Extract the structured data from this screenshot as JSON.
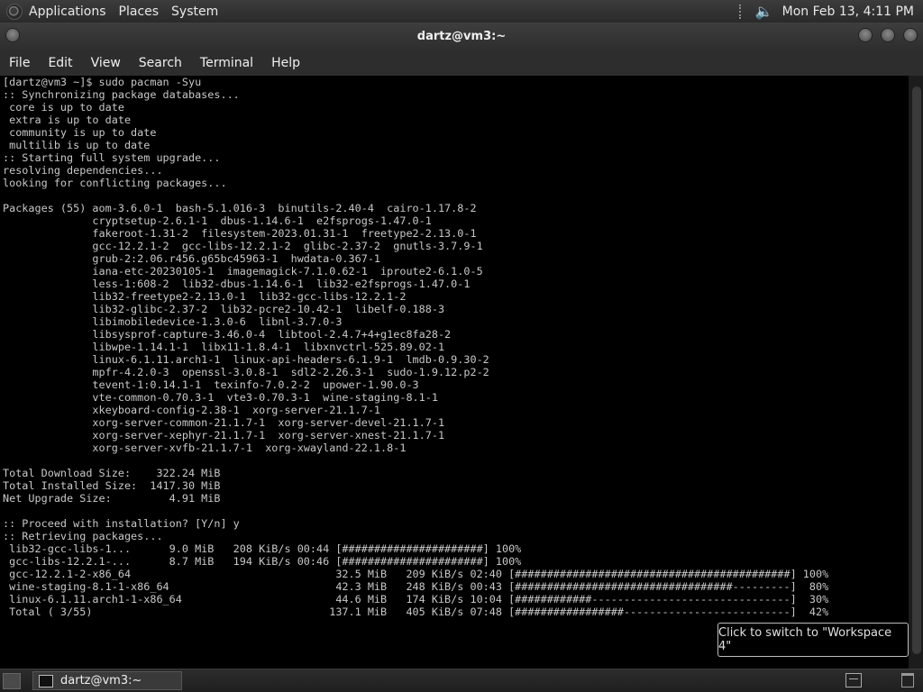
{
  "top_panel": {
    "menu": [
      "Applications",
      "Places",
      "System"
    ],
    "clock": "Mon Feb 13,  4:11 PM"
  },
  "window": {
    "title": "dartz@vm3:~",
    "menu": [
      "File",
      "Edit",
      "View",
      "Search",
      "Terminal",
      "Help"
    ]
  },
  "terminal": {
    "lines": [
      "[dartz@vm3 ~]$ sudo pacman -Syu",
      ":: Synchronizing package databases...",
      " core is up to date",
      " extra is up to date",
      " community is up to date",
      " multilib is up to date",
      ":: Starting full system upgrade...",
      "resolving dependencies...",
      "looking for conflicting packages...",
      "",
      "Packages (55) aom-3.6.0-1  bash-5.1.016-3  binutils-2.40-4  cairo-1.17.8-2",
      "              cryptsetup-2.6.1-1  dbus-1.14.6-1  e2fsprogs-1.47.0-1",
      "              fakeroot-1.31-2  filesystem-2023.01.31-1  freetype2-2.13.0-1",
      "              gcc-12.2.1-2  gcc-libs-12.2.1-2  glibc-2.37-2  gnutls-3.7.9-1",
      "              grub-2:2.06.r456.g65bc45963-1  hwdata-0.367-1",
      "              iana-etc-20230105-1  imagemagick-7.1.0.62-1  iproute2-6.1.0-5",
      "              less-1:608-2  lib32-dbus-1.14.6-1  lib32-e2fsprogs-1.47.0-1",
      "              lib32-freetype2-2.13.0-1  lib32-gcc-libs-12.2.1-2",
      "              lib32-glibc-2.37-2  lib32-pcre2-10.42-1  libelf-0.188-3",
      "              libimobiledevice-1.3.0-6  libnl-3.7.0-3",
      "              libsysprof-capture-3.46.0-4  libtool-2.4.7+4+g1ec8fa28-2",
      "              libwpe-1.14.1-1  libx11-1.8.4-1  libxnvctrl-525.89.02-1",
      "              linux-6.1.11.arch1-1  linux-api-headers-6.1.9-1  lmdb-0.9.30-2",
      "              mpfr-4.2.0-3  openssl-3.0.8-1  sdl2-2.26.3-1  sudo-1.9.12.p2-2",
      "              tevent-1:0.14.1-1  texinfo-7.0.2-2  upower-1.90.0-3",
      "              vte-common-0.70.3-1  vte3-0.70.3-1  wine-staging-8.1-1",
      "              xkeyboard-config-2.38-1  xorg-server-21.1.7-1",
      "              xorg-server-common-21.1.7-1  xorg-server-devel-21.1.7-1",
      "              xorg-server-xephyr-21.1.7-1  xorg-server-xnest-21.1.7-1",
      "              xorg-server-xvfb-21.1.7-1  xorg-xwayland-22.1.8-1",
      "",
      "Total Download Size:    322.24 MiB",
      "Total Installed Size:  1417.30 MiB",
      "Net Upgrade Size:         4.91 MiB",
      "",
      ":: Proceed with installation? [Y/n] y",
      ":: Retrieving packages...",
      " lib32-gcc-libs-1...      9.0 MiB   208 KiB/s 00:44 [######################] 100%",
      " gcc-libs-12.2.1-...      8.7 MiB   194 KiB/s 00:46 [######################] 100%",
      " gcc-12.2.1-2-x86_64                                32.5 MiB   209 KiB/s 02:40 [###########################################] 100%",
      " wine-staging-8.1-1-x86_64                          42.3 MiB   248 KiB/s 00:43 [##################################---------]  80%",
      " linux-6.1.11.arch1-1-x86_64                        44.6 MiB   174 KiB/s 10:04 [############-------------------------------]  30%",
      " Total ( 3/55)                                     137.1 MiB   405 KiB/s 07:48 [#################--------------------------]  42%"
    ]
  },
  "tooltip": "Click to switch to \"Workspace 4\"",
  "taskbar": {
    "task_label": "dartz@vm3:~"
  }
}
